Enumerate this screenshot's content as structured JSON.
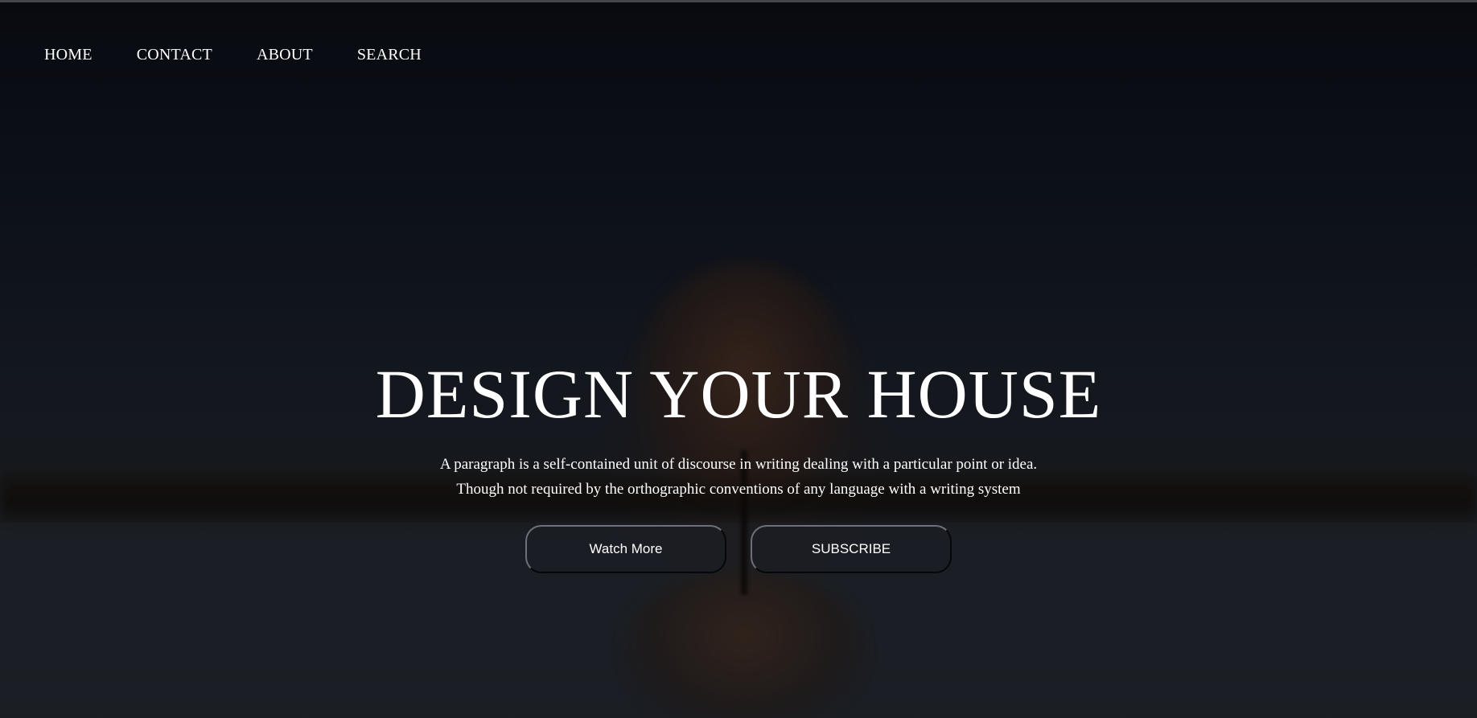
{
  "nav": {
    "items": [
      {
        "label": "HOME"
      },
      {
        "label": "CONTACT"
      },
      {
        "label": "ABOUT"
      },
      {
        "label": "SEARCH"
      }
    ]
  },
  "hero": {
    "title": "DESIGN YOUR HOUSE",
    "description_line1": "A paragraph is a self-contained unit of discourse in writing dealing with a particular point or idea.",
    "description_line2": "Though not required by the orthographic conventions of any language with a writing system",
    "buttons": {
      "watch_more": "Watch More",
      "subscribe": "SUBSCRIBE"
    }
  },
  "colors": {
    "text": "#ffffff",
    "background": "#0d1016",
    "button_border": "#6d7078"
  }
}
